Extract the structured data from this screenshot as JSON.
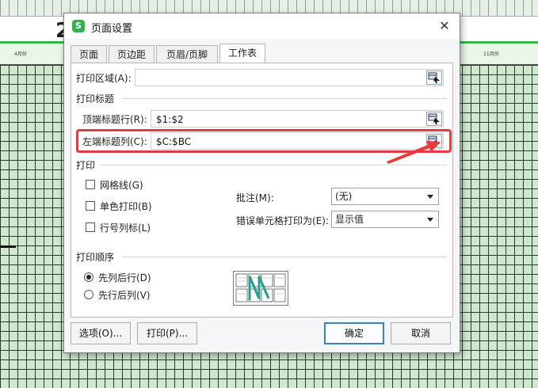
{
  "background": {
    "digit": "2",
    "months": [
      "4月份",
      "11月份"
    ]
  },
  "dialog": {
    "app_icon": "S",
    "title": "页面设置",
    "close_glyph": "✕",
    "tabs": [
      {
        "label": "页面",
        "active": false
      },
      {
        "label": "页边距",
        "active": false
      },
      {
        "label": "页眉/页脚",
        "active": false
      },
      {
        "label": "工作表",
        "active": true
      }
    ],
    "print_area": {
      "label": "打印区域(A):",
      "value": ""
    },
    "print_titles": {
      "section": "打印标题",
      "rows": {
        "label": "顶端标题行(R):",
        "value": "$1:$2"
      },
      "cols": {
        "label": "左端标题列(C):",
        "value": "$C:$BC"
      }
    },
    "print": {
      "section": "打印",
      "gridlines": {
        "label": "网格线(G)",
        "checked": false
      },
      "mono": {
        "label": "单色打印(B)",
        "checked": false
      },
      "headings": {
        "label": "行号列标(L)",
        "checked": false
      },
      "comments": {
        "label": "批注(M):",
        "value": "(无)"
      },
      "errors": {
        "label": "错误单元格打印为(E):",
        "value": "显示值"
      }
    },
    "order": {
      "section": "打印顺序",
      "down_then_over": {
        "label": "先列后行(D)",
        "selected": true
      },
      "over_then_down": {
        "label": "先行后列(V)",
        "selected": false
      }
    },
    "buttons": {
      "options": "选项(O)...",
      "print": "打印(P)...",
      "ok": "确定",
      "cancel": "取消"
    }
  },
  "colors": {
    "accent": "#3c7fc7",
    "highlight": "#e83a3a",
    "sheet_green": "#3bb34a"
  }
}
